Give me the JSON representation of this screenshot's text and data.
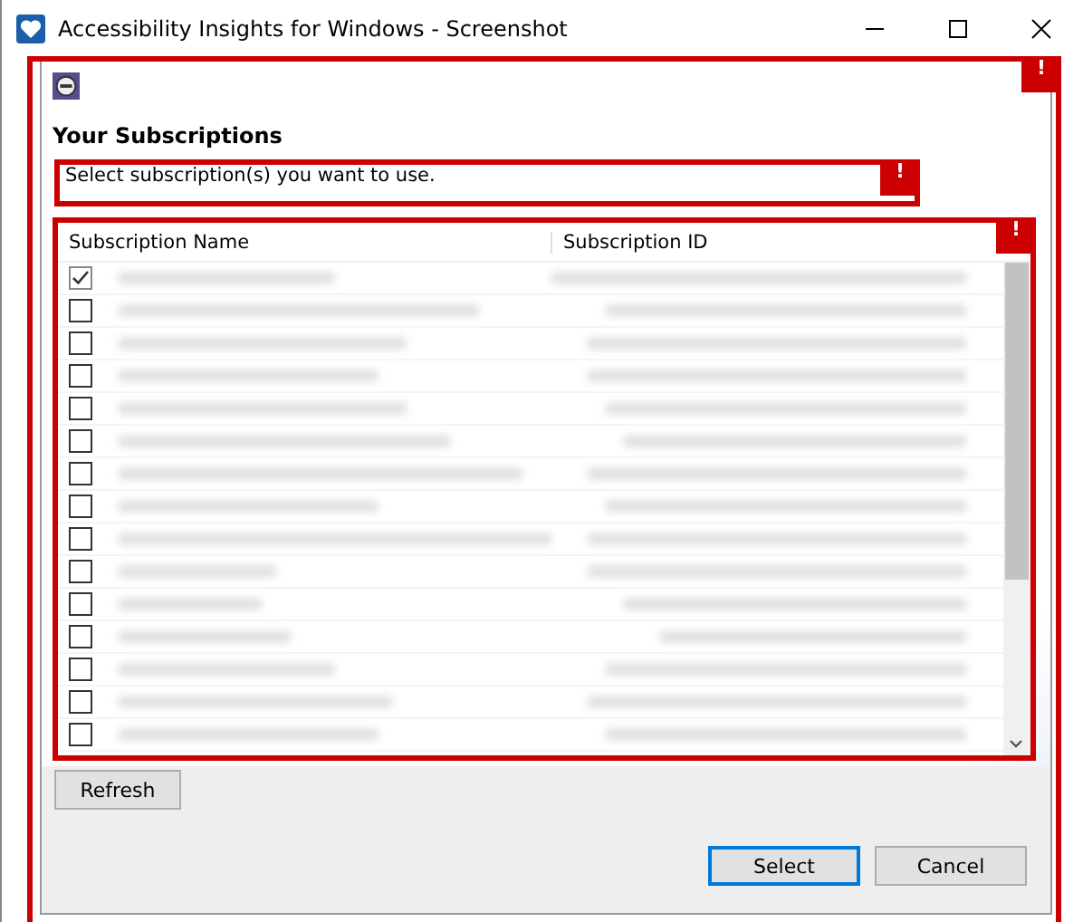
{
  "window": {
    "title": "Accessibility Insights for Windows - Screenshot"
  },
  "dialog": {
    "heading": "Your Subscriptions",
    "error_mark": "!",
    "description": {
      "text": "Select subscription(s) you want to use.",
      "error_mark": "!"
    },
    "table": {
      "error_mark": "!",
      "columns": [
        "Subscription Name",
        "Subscription ID"
      ],
      "rows": [
        {
          "checked": true
        },
        {
          "checked": false
        },
        {
          "checked": false
        },
        {
          "checked": false
        },
        {
          "checked": false
        },
        {
          "checked": false
        },
        {
          "checked": false
        },
        {
          "checked": false
        },
        {
          "checked": false
        },
        {
          "checked": false
        },
        {
          "checked": false
        },
        {
          "checked": false
        },
        {
          "checked": false
        },
        {
          "checked": false
        },
        {
          "checked": false
        }
      ]
    },
    "buttons": {
      "refresh": "Refresh",
      "select": "Select",
      "cancel": "Cancel"
    }
  }
}
